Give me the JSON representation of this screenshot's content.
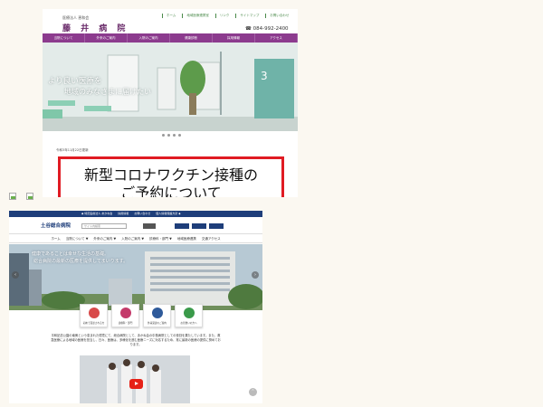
{
  "site1": {
    "subtitle": "医療法人 恵和会",
    "title": "藤 井 病 院",
    "top_links": [
      "ホーム",
      "地域医療連携室",
      "リンク",
      "サイトマップ",
      "お問い合わせ"
    ],
    "phone": "☎ 084-992-2400",
    "nav": [
      "当院について",
      "外来のご案内",
      "入院のご案内",
      "健康診断",
      "採用情報",
      "アクセス"
    ],
    "hero_caption_1": "より良い医療を",
    "hero_caption_2": "地域のみなさまに届けたい",
    "hero_room_number": "3",
    "notice_date": "令和3年11月22日更新",
    "banner_line_1": "新型コロナワクチン接種の",
    "banner_line_2": "ご予約について",
    "slider_dots": 4
  },
  "site2": {
    "topbar_links": [
      "◆ 特定医療法人 あかね会",
      "採用情報",
      "お問い合わせ",
      "個人情報保護方針 ◆"
    ],
    "logo": "土谷総合病院",
    "search_placeholder": "サイト内検索",
    "nav": [
      "ホーム",
      "当院について ▼",
      "外来のご案内 ▼",
      "入院のご案内 ▼",
      "診療科・部門 ▼",
      "地域医療連携",
      "交通アクセス"
    ],
    "hero_caption_1": "健康であることは幸せな生活の基礎。",
    "hero_caption_2": "総合病院の最新の医療を提供してまいります。",
    "arrow_left": "‹",
    "arrow_right": "›",
    "quick_links": [
      {
        "label": "初めて受診される方",
        "color": "#d84a4a"
      },
      {
        "label": "診療科・部門",
        "color": "#c43a6a"
      },
      {
        "label": "外来受診のご案内",
        "color": "#2e5a9a"
      },
      {
        "label": "お見舞いの方へ",
        "color": "#3a9a4a"
      }
    ],
    "intro_text": "平和記念公園の南側という恵まれた環境にて、総合病院として、あかね会の中核病院としての役割を果たしています。また、救急医療による地域の医療を担当し、日々、医療は、多様化を進む医療ニーズに対応するため、常に最新の医療の提供に努めております。",
    "scroll_top": "⌃",
    "colors": {
      "navy": "#1e3e7a",
      "purple": "#8c3b8e",
      "red_border": "#e01b23"
    }
  }
}
